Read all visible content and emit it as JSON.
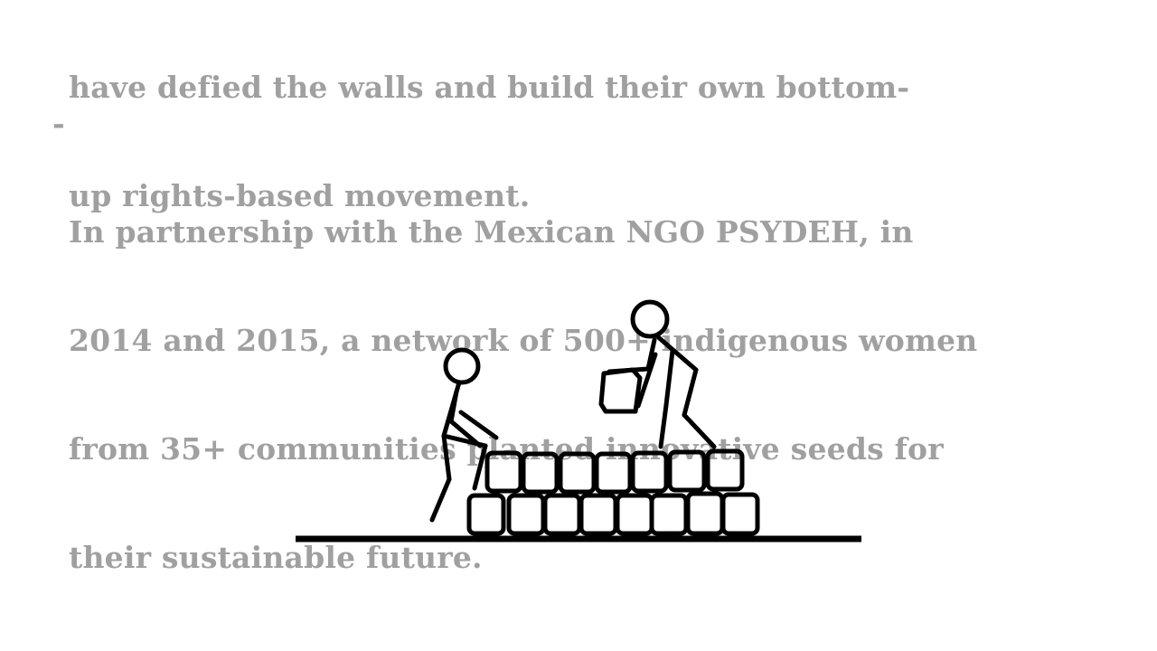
{
  "paragraph_1": {
    "lines": [
      "have defied the walls and build their own bottom-",
      "up rights-based movement."
    ]
  },
  "paragraph_2": {
    "bullet": "-",
    "lines": [
      "In partnership with the Mexican NGO PSYDEH, in",
      "2014 and 2015, a network of 500+ indigenous women",
      "from 35+ communities planted innovative seeds for",
      "their sustainable future."
    ]
  },
  "illustration": {
    "icon": "stick-figures-building-wall-icon"
  }
}
